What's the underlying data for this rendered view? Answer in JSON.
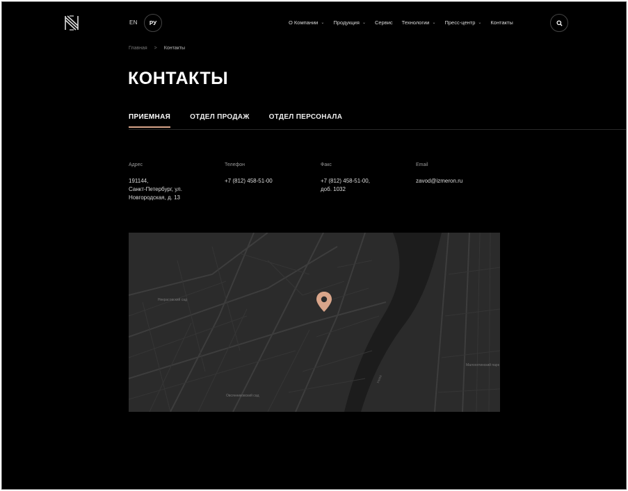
{
  "header": {
    "lang_en": "EN",
    "lang_ru": "РУ",
    "nav": [
      {
        "label": "О Компании",
        "has_dropdown": true
      },
      {
        "label": "Продукция",
        "has_dropdown": true
      },
      {
        "label": "Сервис",
        "has_dropdown": false
      },
      {
        "label": "Технологии",
        "has_dropdown": true
      },
      {
        "label": "Пресс-центр",
        "has_dropdown": true
      },
      {
        "label": "Контакты",
        "has_dropdown": false
      }
    ],
    "dropdown_glyph": "⌄"
  },
  "breadcrumb": {
    "home": "Главная",
    "separator": ">",
    "current": "Контакты"
  },
  "page_title": "КОНТАКТЫ",
  "tabs": [
    {
      "label": "ПРИЕМНАЯ",
      "active": true
    },
    {
      "label": "ОТДЕЛ ПРОДАЖ",
      "active": false
    },
    {
      "label": "ОТДЕЛ ПЕРСОНАЛА",
      "active": false
    }
  ],
  "contacts": {
    "address": {
      "label": "Адрес",
      "lines": [
        "191144,",
        "Санкт-Петербург, ул.",
        "Новгородская, д. 13"
      ]
    },
    "phone": {
      "label": "Телефон",
      "lines": [
        "+7 (812) 458-51-00"
      ]
    },
    "fax": {
      "label": "Факс",
      "lines": [
        "+7 (812) 458-51-00,",
        "доб. 1032"
      ]
    },
    "email": {
      "label": "Email",
      "lines": [
        "zavod@izmeron.ru"
      ]
    }
  },
  "map": {
    "labels": [
      {
        "text": "Некрасовский сад"
      },
      {
        "text": "Малоохтинский парк"
      },
      {
        "text": "Овсянниковский сад"
      },
      {
        "text": "Нева"
      }
    ]
  },
  "colors": {
    "accent": "#d9a58a",
    "background": "#000000",
    "map_bg": "#2b2b2b",
    "river": "#1c1c1c"
  }
}
